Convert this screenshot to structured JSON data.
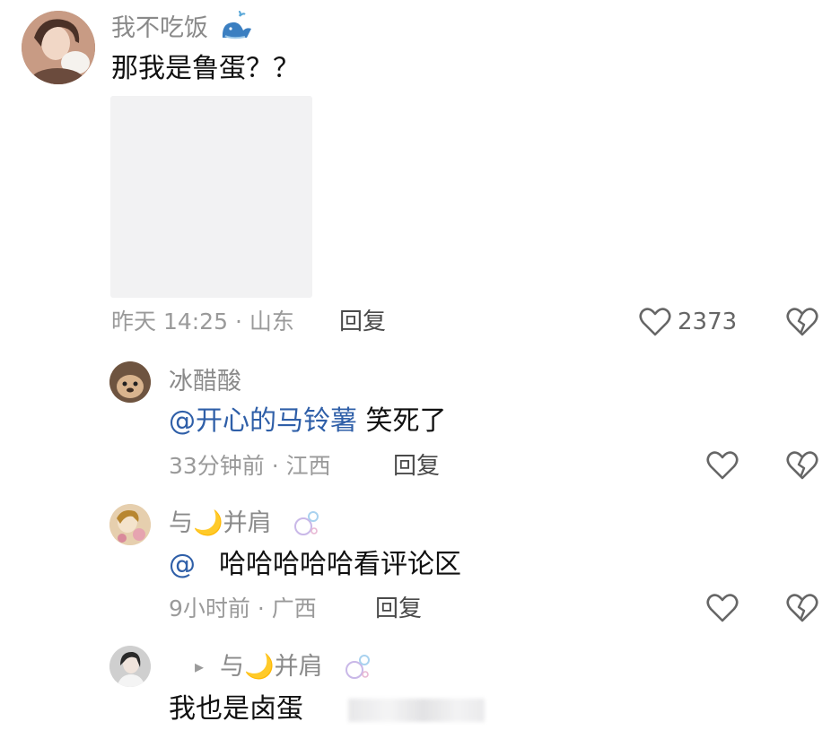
{
  "comment": {
    "username": "我不吃饭",
    "username_badge_icon": "whale-icon",
    "text": "那我是鲁蛋？？",
    "time_location": "昨天 14:25 · 山东",
    "reply_label": "回复",
    "like_count": "2373"
  },
  "replies": [
    {
      "username": "冰醋酸",
      "mention": "@开心的马铃薯",
      "text": " 笑死了",
      "time_location": "33分钟前 · 江西",
      "reply_label": "回复"
    },
    {
      "username": "与🌙并肩",
      "mention": "@",
      "text": "哈哈哈哈哈看评论区",
      "time_location": "9小时前 · 广西",
      "reply_label": "回复"
    },
    {
      "reply_arrow": "▸",
      "username": "与🌙并肩",
      "text": "我也是卤蛋"
    }
  ],
  "colors": {
    "mention": "#2f5fa8",
    "meta": "#9a9a9a",
    "image_placeholder": "#f2f2f3"
  }
}
